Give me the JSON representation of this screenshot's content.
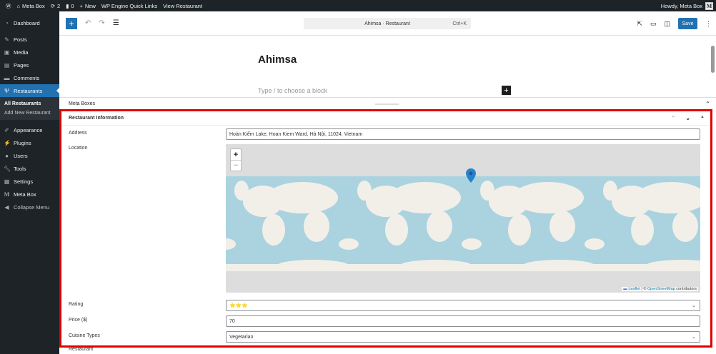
{
  "adminbar": {
    "site": "Meta Box",
    "updates": "2",
    "comments": "0",
    "new": "New",
    "quicklinks": "WP Engine Quick Links",
    "view": "View Restaurant",
    "howdy": "Howdy, Meta Box",
    "avatar": "M"
  },
  "sidebar": {
    "items": [
      {
        "label": "Dashboard",
        "icon": "dashboard-icon"
      },
      {
        "label": "Posts",
        "icon": "pin-icon"
      },
      {
        "label": "Media",
        "icon": "media-icon"
      },
      {
        "label": "Pages",
        "icon": "pages-icon"
      },
      {
        "label": "Comments",
        "icon": "comment-icon"
      },
      {
        "label": "Restaurants",
        "icon": "utensils-icon",
        "active": true
      },
      {
        "label": "Appearance",
        "icon": "brush-icon"
      },
      {
        "label": "Plugins",
        "icon": "plugin-icon"
      },
      {
        "label": "Users",
        "icon": "users-icon"
      },
      {
        "label": "Tools",
        "icon": "wrench-icon"
      },
      {
        "label": "Settings",
        "icon": "settings-icon"
      },
      {
        "label": "Meta Box",
        "icon": "metabox-icon"
      },
      {
        "label": "Collapse Menu",
        "icon": "collapse-icon"
      }
    ],
    "submenu": [
      "All Restaurants",
      "Add New Restaurant"
    ]
  },
  "toolbar": {
    "command": "Ahimsa · Restaurant",
    "shortcut": "Ctrl+K",
    "save": "Save"
  },
  "post": {
    "title": "Ahimsa",
    "placeholder": "Type / to choose a block"
  },
  "metaboxes": {
    "label": "Meta Boxes"
  },
  "box": {
    "title": "Restaurant Information",
    "address_label": "Address",
    "address": "Hoàn Kiếm Lake, Hoan Kiem Ward, Hà Nội, 11024, Vietnam",
    "location_label": "Location",
    "map": {
      "zoom_in": "+",
      "zoom_out": "−",
      "leaflet": "Leaflet",
      "sep": " | © ",
      "osm": "OpenStreetMap",
      "contrib": " contributors"
    },
    "rating_label": "Rating",
    "rating": "⭐⭐⭐",
    "rating_stars": 3,
    "price_label": "Price ($)",
    "price": "70",
    "cuisine_label": "Cuisine Types",
    "cuisine": "Vegetarian"
  },
  "next_box": "Restaurant",
  "colors": {
    "accent": "#2271b1",
    "highlight": "#e00000",
    "ocean": "#aad3df",
    "land": "#f2efe9"
  }
}
